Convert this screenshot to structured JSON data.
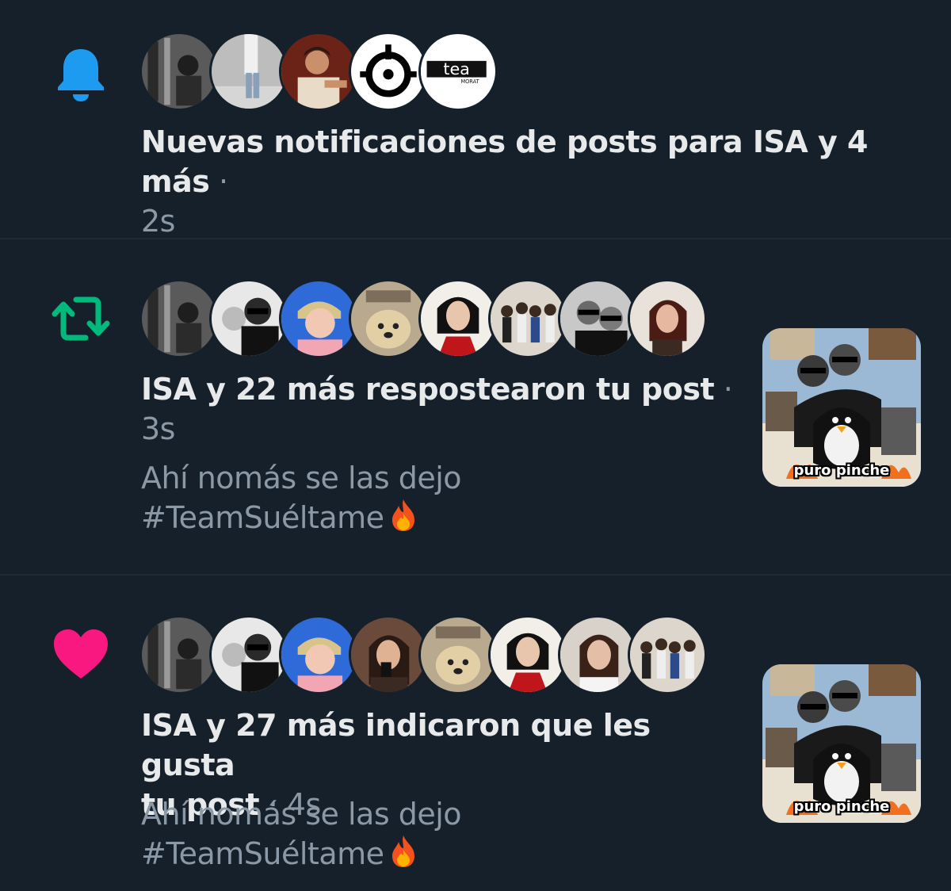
{
  "colors": {
    "background": "#15202b",
    "divider": "#1e2a35",
    "bell": "#1d9bf0",
    "repost": "#00ba7c",
    "like": "#f91880",
    "text_primary": "#e7e9ea",
    "text_secondary": "#8b98a5"
  },
  "notifications": [
    {
      "type": "post_notification",
      "icon": "bell-icon",
      "avatar_count": 5,
      "headline_main": "Nuevas notificaciones de posts para ISA y 4 más",
      "separator": " · ",
      "time": "2s"
    },
    {
      "type": "repost",
      "icon": "repost-icon",
      "avatar_count": 8,
      "headline_main": "ISA y 22 más respostearon tu post",
      "separator": " · ",
      "time": "3s",
      "post_text_line1": "Ahí nomás se las dejo",
      "post_text_line2": "#TeamSuéltame",
      "thumbnail_caption": "puro pinche"
    },
    {
      "type": "like",
      "icon": "heart-icon",
      "avatar_count": 8,
      "headline_line1": "ISA y 27 más indicaron que les gusta",
      "headline_line2": "tu post",
      "separator": " · ",
      "time": "4s",
      "post_text_line1": "Ahí nomás se las dejo",
      "post_text_line2": "#TeamSuéltame",
      "thumbnail_caption": "puro pinche"
    }
  ],
  "avatar_logo_text": "tea",
  "avatar_logo_subtext": "MORAT"
}
